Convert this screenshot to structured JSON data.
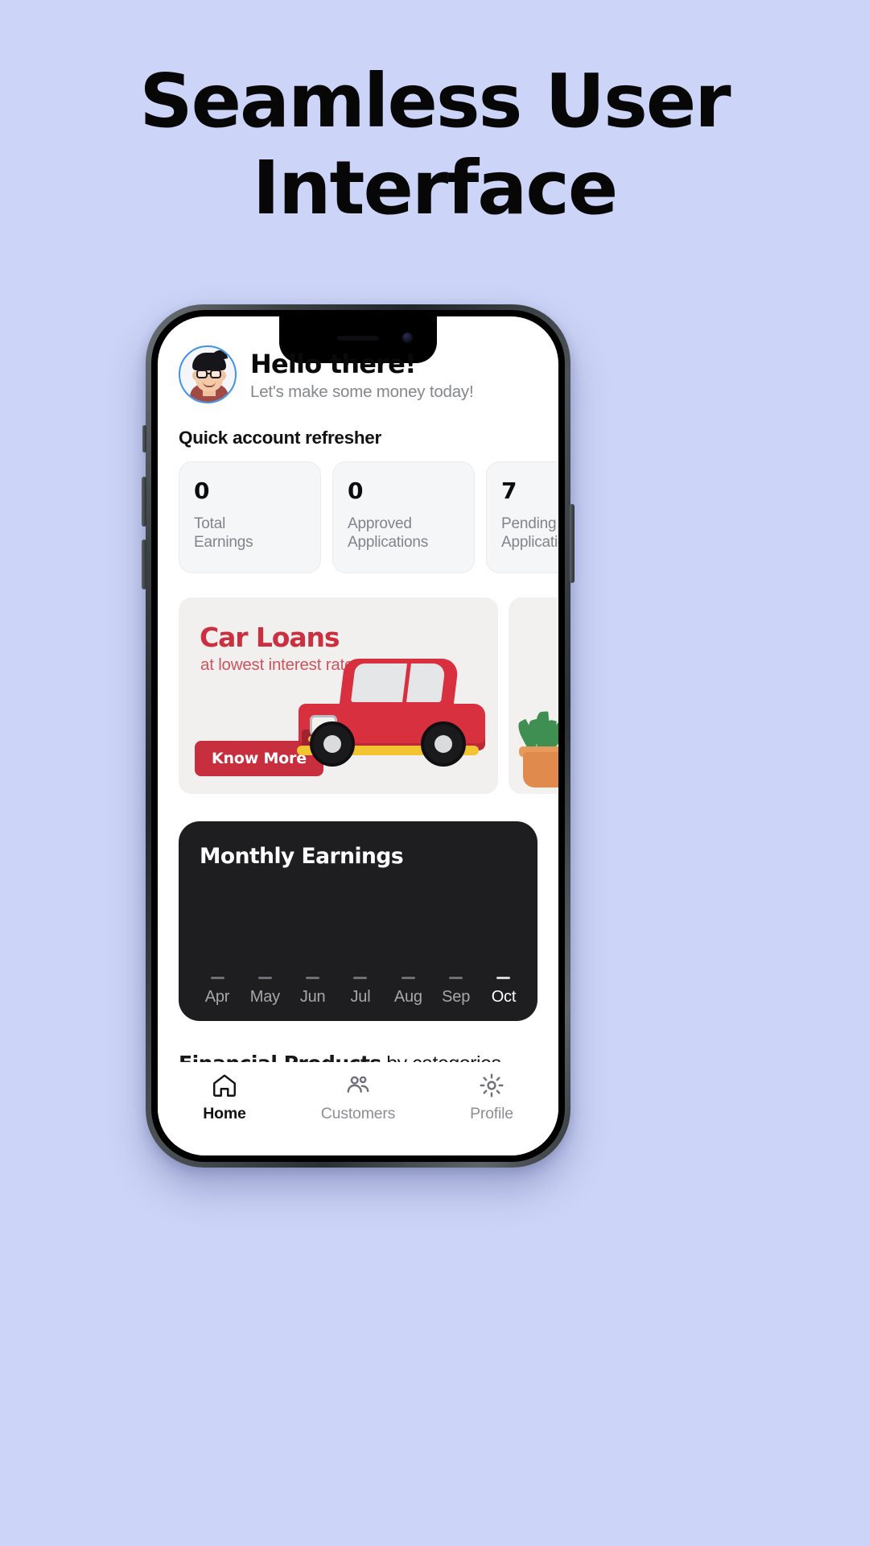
{
  "headline": {
    "line1": "Seamless User",
    "line2": "Interface"
  },
  "app": {
    "header": {
      "avatar_icon": "memoji-avatar-icon",
      "greeting": "Hello there!",
      "subtitle": "Let's make some money today!"
    },
    "quick_account": {
      "section_title": "Quick account refresher",
      "cards": [
        {
          "value": "0",
          "label_line1": "Total",
          "label_line2": "Earnings"
        },
        {
          "value": "0",
          "label_line1": "Approved",
          "label_line2": "Applications"
        },
        {
          "value": "7",
          "label_line1": "Pending",
          "label_line2": "Applications"
        }
      ]
    },
    "promos": [
      {
        "title": "Car Loans",
        "subtitle": "at lowest interest rates.",
        "button": "Know More",
        "illustration": "red-car-icon",
        "accent": "#cc2f3f"
      },
      {
        "title": "",
        "subtitle": "",
        "button": "",
        "illustration": "potted-plant-icon",
        "accent": "#f0b944"
      }
    ],
    "earnings": {
      "title": "Monthly Earnings",
      "card_color": "#1e1e20"
    },
    "financial_products": {
      "title_bold": "Financial Products",
      "title_rest": " by categories",
      "underline_color": "#5fa8f5"
    },
    "bottom_nav": [
      {
        "label": "Home",
        "icon": "home-icon",
        "active": true
      },
      {
        "label": "Customers",
        "icon": "people-icon",
        "active": false
      },
      {
        "label": "Profile",
        "icon": "gear-icon",
        "active": false
      }
    ]
  },
  "chart_data": {
    "type": "bar",
    "title": "Monthly Earnings",
    "categories": [
      "Apr",
      "May",
      "Jun",
      "Jul",
      "Aug",
      "Sep",
      "Oct"
    ],
    "values": [
      0,
      0,
      0,
      0,
      0,
      0,
      0
    ],
    "xlabel": "",
    "ylabel": "",
    "ylim": [
      0,
      0
    ],
    "grid": false,
    "legend": "none",
    "highlighted_category": "Oct"
  },
  "theme": {
    "page_background": "#ccd4f7",
    "headline_color": "#070707",
    "accent_blue": "#5fa8f5",
    "accent_red": "#c72e3e",
    "dark_card": "#1e1e20"
  }
}
